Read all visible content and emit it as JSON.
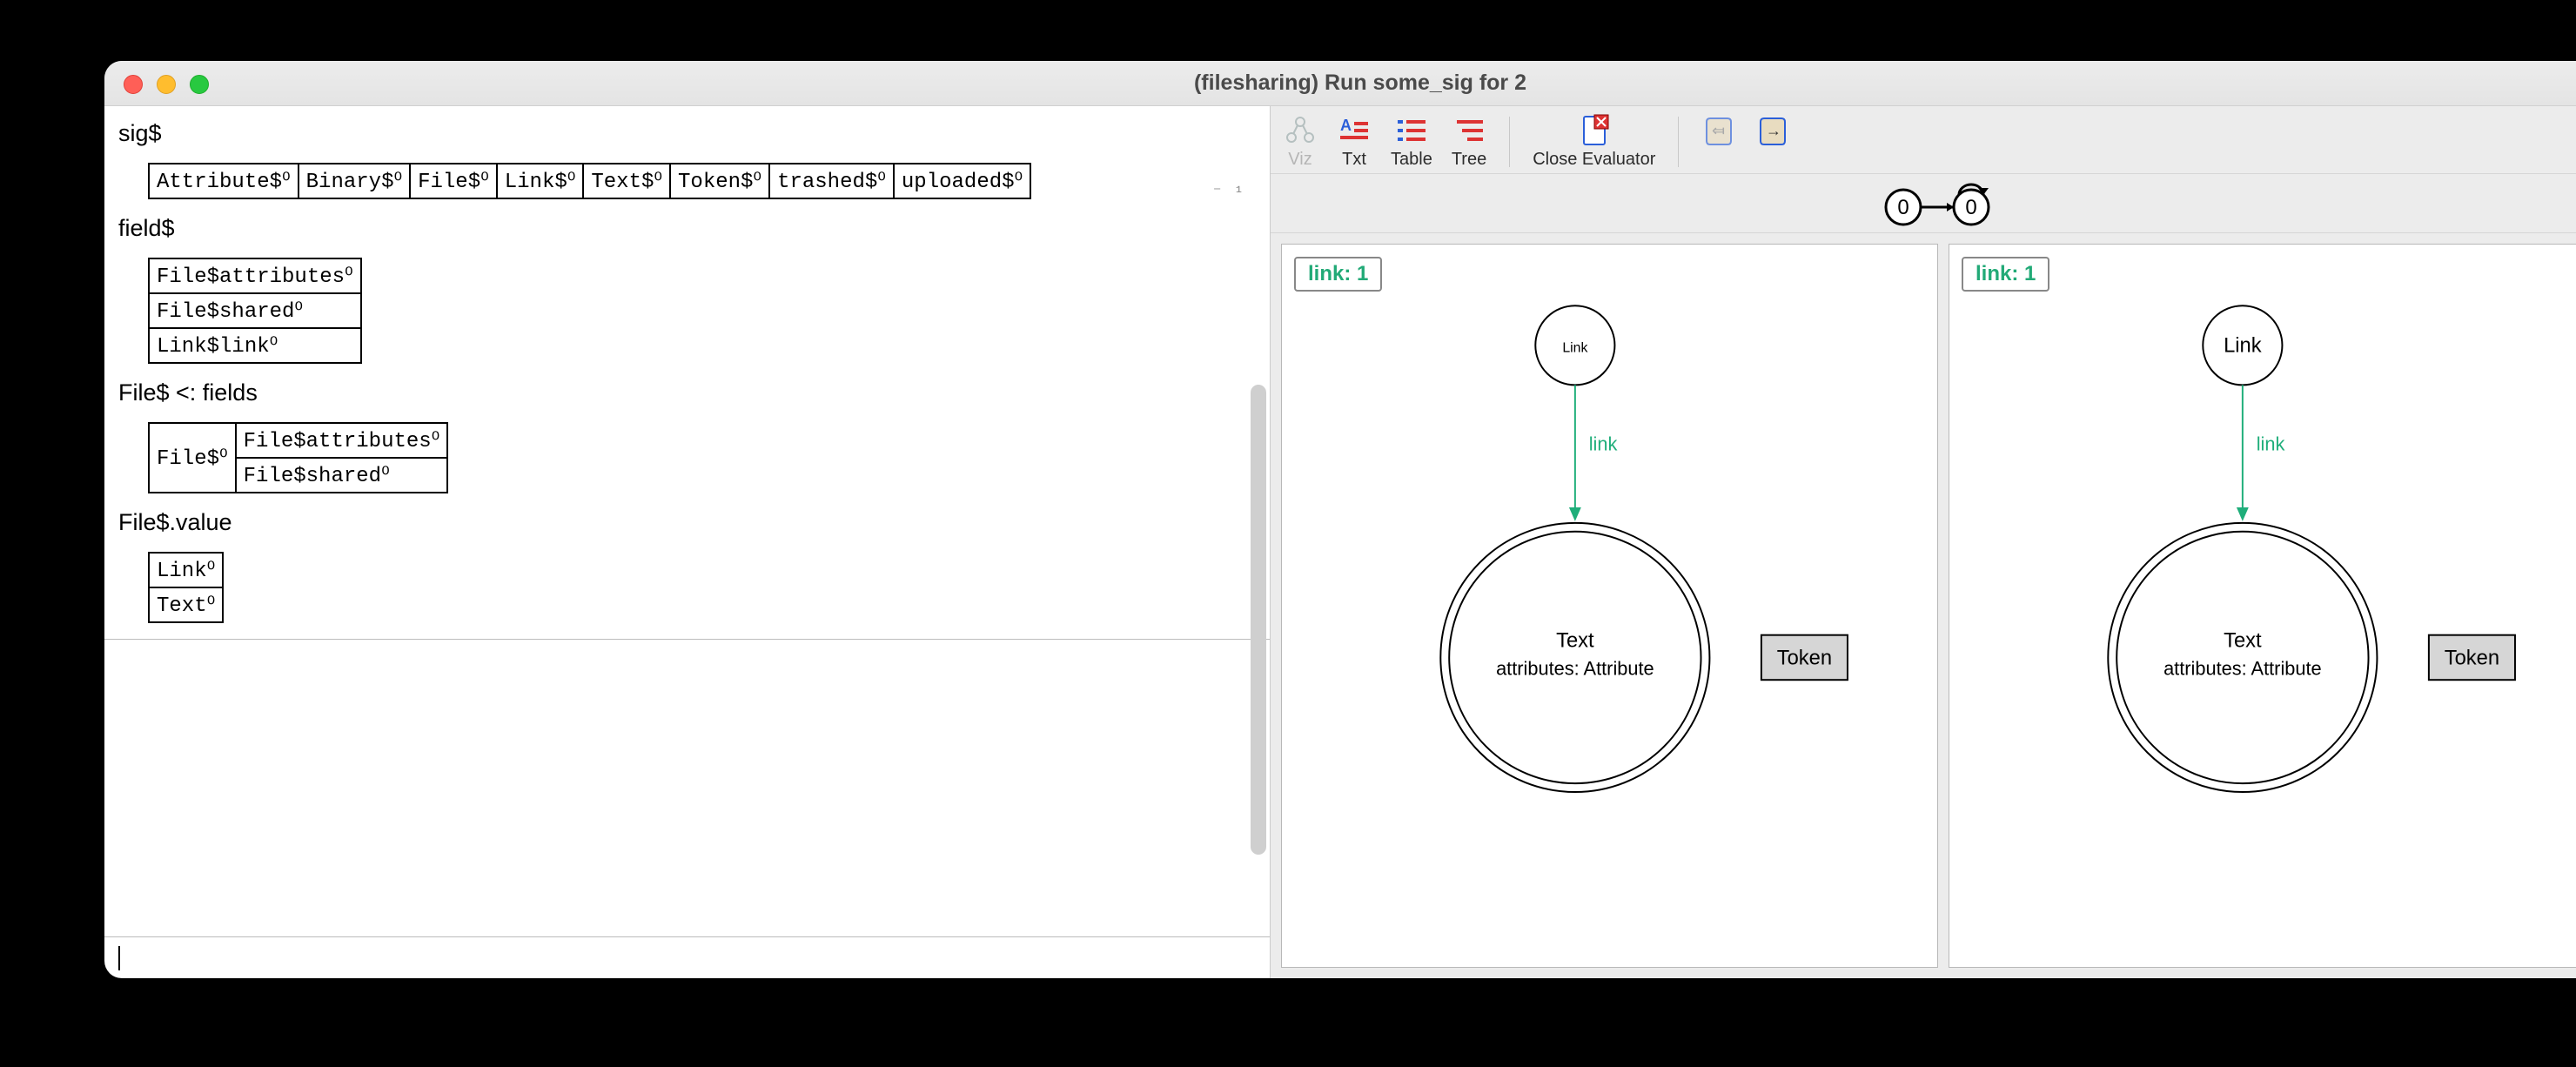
{
  "window": {
    "title": "(filesharing) Run some_sig for 2"
  },
  "left": {
    "corner_marker": "⁻ ¹",
    "sections": [
      {
        "label": "sig$",
        "rows": [
          [
            "Attribute$⁰",
            "Binary$⁰",
            "File$⁰",
            "Link$⁰",
            "Text$⁰",
            "Token$⁰",
            "trashed$⁰",
            "uploaded$⁰"
          ]
        ]
      },
      {
        "label": "field$",
        "rows": [
          [
            "File$attributes⁰"
          ],
          [
            "File$shared⁰"
          ],
          [
            "Link$link⁰"
          ]
        ]
      },
      {
        "label": "File$ <: fields",
        "rows": [
          [
            "File$⁰",
            "File$attributes⁰"
          ],
          [
            "",
            "File$shared⁰"
          ]
        ]
      },
      {
        "label": "File$.value",
        "rows": [
          [
            "Link⁰"
          ],
          [
            "Text⁰"
          ]
        ]
      }
    ]
  },
  "toolbar": {
    "viz": "Viz",
    "txt": "Txt",
    "table": "Table",
    "tree": "Tree",
    "close": "Close Evaluator",
    "prev": "⤆",
    "next": "→"
  },
  "trace": {
    "state0": "0",
    "state1": "0"
  },
  "viz": {
    "badge": "link: 1",
    "link_node": "Link",
    "edge": "link",
    "text_node_l1": "Text",
    "text_node_l2": "attributes: Attribute",
    "token": "Token"
  }
}
